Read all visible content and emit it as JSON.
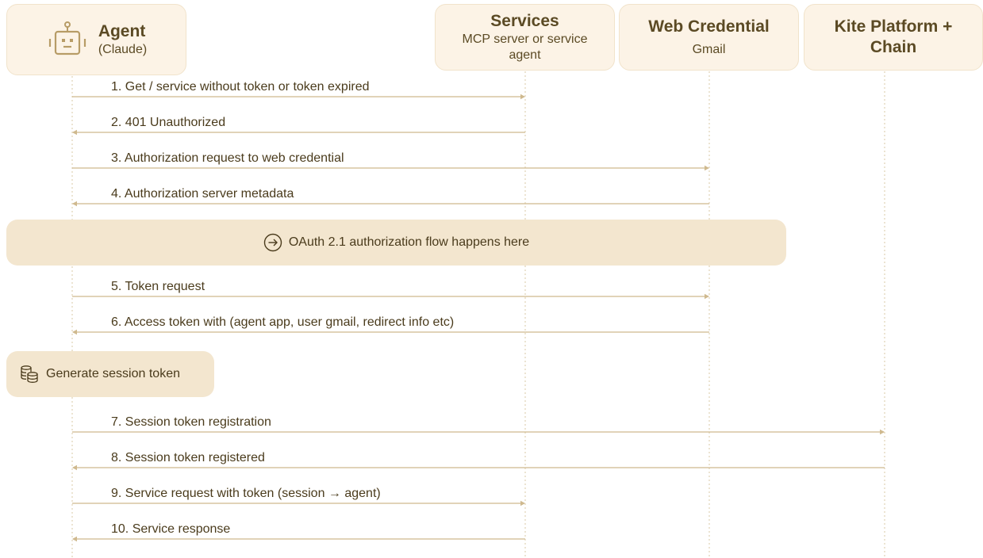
{
  "participants": {
    "agent": {
      "title": "Agent",
      "subtitle": "(Claude)",
      "icon": "robot-icon"
    },
    "services": {
      "title": "Services",
      "subtitle": "MCP server or service agent"
    },
    "web_credential": {
      "title": "Web Credential",
      "subtitle": "Gmail"
    },
    "kite": {
      "title": "Kite Platform + Chain"
    }
  },
  "messages": [
    {
      "label": "1. Get / service without token or token expired",
      "from": "agent",
      "to": "services"
    },
    {
      "label": "2. 401 Unauthorized",
      "from": "services",
      "to": "agent"
    },
    {
      "label": "3. Authorization request to web credential",
      "from": "agent",
      "to": "web_credential"
    },
    {
      "label": "4. Authorization server metadata",
      "from": "web_credential",
      "to": "agent"
    },
    {
      "label": "5. Token request",
      "from": "agent",
      "to": "web_credential"
    },
    {
      "label": "6. Access token with (agent app, user gmail, redirect info etc)",
      "from": "web_credential",
      "to": "agent"
    },
    {
      "label": "7. Session token registration",
      "from": "agent",
      "to": "kite"
    },
    {
      "label": "8. Session token registered",
      "from": "kite",
      "to": "agent"
    },
    {
      "label": "9. Service request with token (session → agent)",
      "from": "agent",
      "to": "services"
    },
    {
      "label": "10. Service response",
      "from": "services",
      "to": "agent"
    }
  ],
  "notes": {
    "oauth": {
      "text": "OAuth 2.1 authorization flow happens here",
      "icon": "arrow-circle-right-icon"
    },
    "session": {
      "text": "Generate session token",
      "icon": "database-icon"
    }
  },
  "colors": {
    "line": "#cfb98e",
    "lifeline": "#d9c8a6",
    "box_fill": "#fcf3e6",
    "band_fill": "#f3e6cf",
    "text": "#4a3b1c"
  }
}
